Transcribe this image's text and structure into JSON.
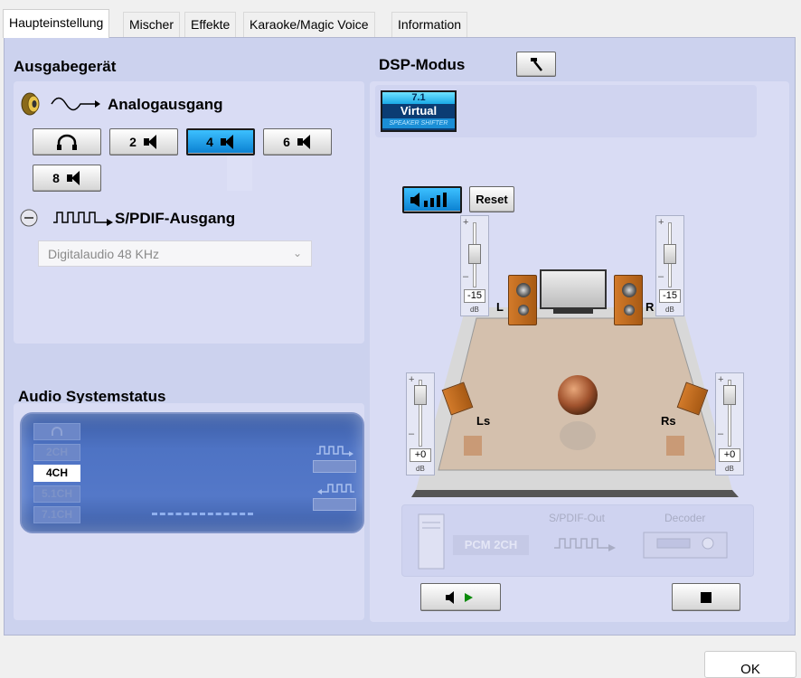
{
  "tabs": [
    {
      "label": "Haupteinstellung"
    },
    {
      "label": "Mischer"
    },
    {
      "label": "Effekte"
    },
    {
      "label": "Karaoke/Magic Voice"
    },
    {
      "label": "Information"
    }
  ],
  "output": {
    "heading": "Ausgabegerät",
    "analog_label": "Analogausgang",
    "buttons": [
      {
        "label": "",
        "icon": "headphones-icon"
      },
      {
        "label": "2",
        "icon": "speaker-icon"
      },
      {
        "label": "4",
        "icon": "speaker-icon",
        "selected": true
      },
      {
        "label": "6",
        "icon": "speaker-icon"
      },
      {
        "label": "8",
        "icon": "speaker-icon"
      }
    ],
    "spdif_label": "S/PDIF-Ausgang",
    "spdif_select": "Digitalaudio  48 KHz"
  },
  "status": {
    "heading": "Audio Systemstatus",
    "channels": [
      "",
      "2CH",
      "4CH",
      "5.1CH",
      "7.1CH"
    ],
    "active_channel": "4CH"
  },
  "dsp": {
    "heading": "DSP-Modus",
    "effect_top": "7.1",
    "effect_mid": "Virtual",
    "effect_bottom": "SPEAKER SHIFTER",
    "reset_label": "Reset",
    "db": {
      "front_left": "-15",
      "front_right": "-15",
      "rear_left": "+0",
      "rear_right": "+0",
      "unit": "dB"
    },
    "labels": {
      "L": "L",
      "R": "R",
      "Ls": "Ls",
      "Rs": "Rs"
    },
    "signal": {
      "pcm": "PCM 2CH",
      "spdif_out": "S/PDIF-Out",
      "decoder": "Decoder"
    }
  },
  "footer": {
    "ok_label": "OK"
  },
  "colors": {
    "panel": "#ccd2ee",
    "accent": "#1a9be8",
    "status_bg": "#4e73c4"
  }
}
